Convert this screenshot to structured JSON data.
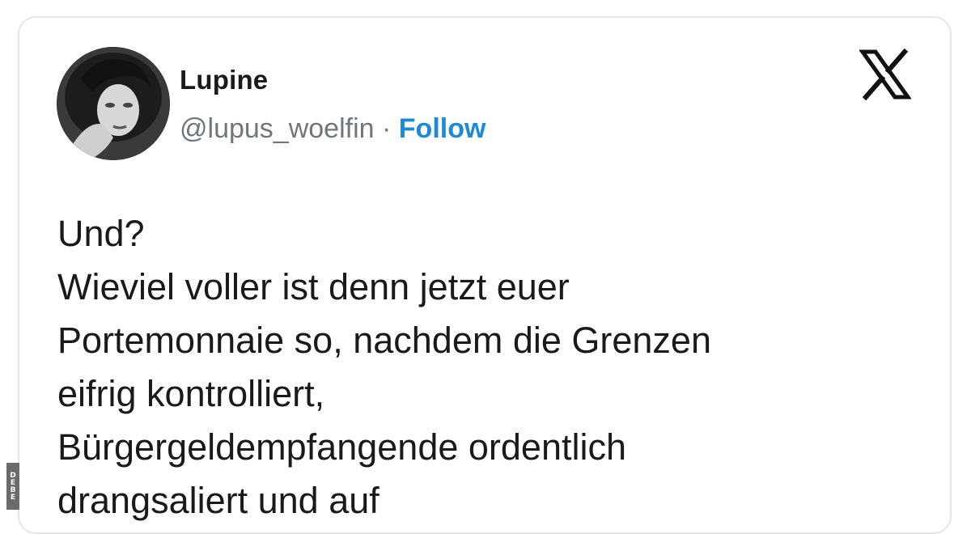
{
  "tweet": {
    "author": {
      "display_name": "Lupine",
      "handle": "@lupus_woelfin",
      "separator": "·",
      "follow_label": "Follow",
      "avatar_icon": "profile-avatar-icon"
    },
    "platform_icon": "x-logo-icon",
    "text_lines": [
      "Und?",
      "Wieviel voller ist denn jetzt euer",
      "Portemonnaie so, nachdem die Grenzen",
      "eifrig kontrolliert,",
      "Bürgergeldempfangende ordentlich",
      "drangsaliert und auf"
    ]
  },
  "watermark": "DEBE",
  "colors": {
    "follow_blue": "#1d8ad8",
    "text": "#1a1a1a",
    "handle_gray": "#6f767d",
    "card_border": "#e3e6ea"
  }
}
